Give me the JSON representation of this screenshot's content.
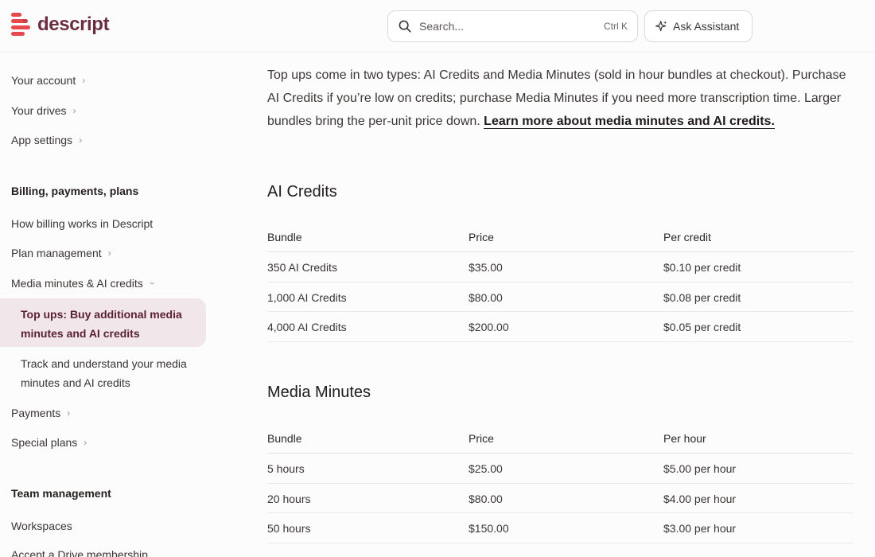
{
  "header": {
    "logo_text": "descript",
    "search_placeholder": "Search...",
    "search_shortcut": "Ctrl K",
    "assistant_label": "Ask Assistant",
    "brand_color": "#e5484d"
  },
  "sidebar": {
    "items_top": [
      {
        "label": "Your account"
      },
      {
        "label": "Your drives"
      },
      {
        "label": "App settings"
      }
    ],
    "section_billing": "Billing, payments, plans",
    "billing_items": [
      {
        "label": "How billing works in Descript"
      },
      {
        "label": "Plan management"
      },
      {
        "label": "Media minutes & AI credits"
      }
    ],
    "active_item": "Top ups: Buy additional media minutes and AI credits",
    "sub_item": "Track and understand your media minutes and AI credits",
    "billing_items_after": [
      {
        "label": "Payments"
      },
      {
        "label": "Special plans"
      }
    ],
    "section_team": "Team management",
    "team_items": [
      {
        "label": "Workspaces"
      },
      {
        "label": "Accept a Drive membership"
      }
    ]
  },
  "main": {
    "intro_text": "Top ups come in two types: AI Credits and Media Minutes (sold in hour bundles at checkout). Purchase AI Credits if you’re low on credits; purchase Media Minutes if you need more transcription time. Larger bundles bring the per-unit price down. ",
    "intro_link": "Learn more about media minutes and AI credits.",
    "ai_credits": {
      "heading": "AI Credits",
      "columns": [
        "Bundle",
        "Price",
        "Per credit"
      ],
      "rows": [
        [
          "350 AI Credits",
          "$35.00",
          "$0.10 per credit"
        ],
        [
          "1,000 AI Credits",
          "$80.00",
          "$0.08 per credit"
        ],
        [
          "4,000 AI Credits",
          "$200.00",
          "$0.05 per credit"
        ]
      ]
    },
    "media_minutes": {
      "heading": "Media Minutes",
      "columns": [
        "Bundle",
        "Price",
        "Per hour"
      ],
      "rows": [
        [
          "5 hours",
          "$25.00",
          "$5.00 per hour"
        ],
        [
          "20 hours",
          "$80.00",
          "$4.00 per hour"
        ],
        [
          "50 hours",
          "$150.00",
          "$3.00 per hour"
        ]
      ]
    }
  }
}
